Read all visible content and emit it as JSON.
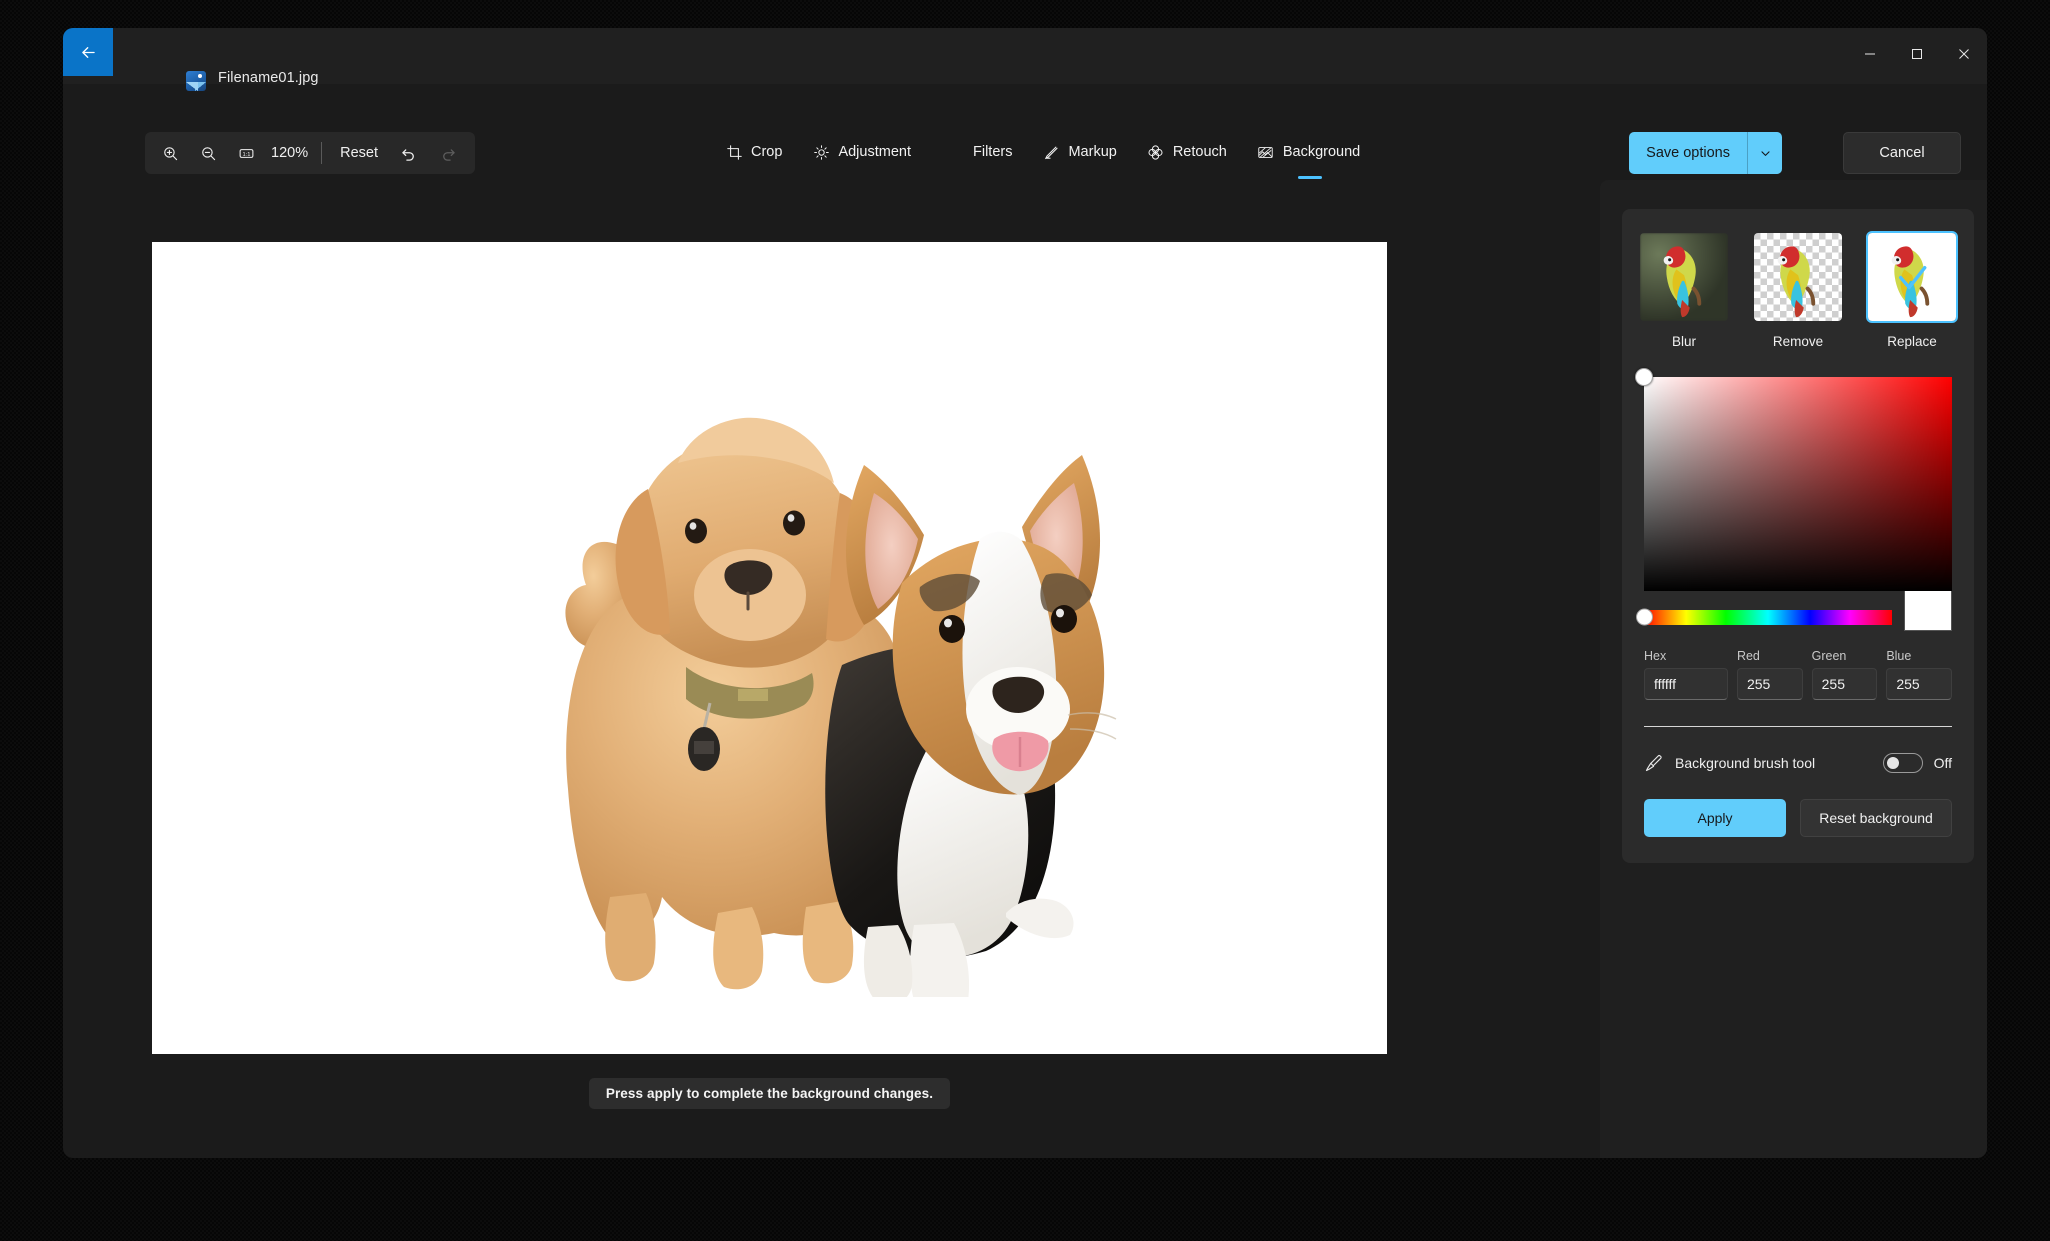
{
  "window": {
    "file_name": "Filename01.jpg",
    "back_label": "back-arrow",
    "controls": {
      "minimize": "minimize",
      "maximize": "maximize",
      "close": "close"
    }
  },
  "toolbar": {
    "zoom_in": "zoom-in",
    "zoom_out": "zoom-out",
    "actual_size": "1:1",
    "zoom_level": "120%",
    "reset_label": "Reset",
    "undo": "undo",
    "redo": "redo",
    "save_options_label": "Save options",
    "cancel_label": "Cancel"
  },
  "tabs": [
    {
      "label": "Crop",
      "icon": "crop-icon",
      "active": false
    },
    {
      "label": "Adjustment",
      "icon": "brightness-icon",
      "active": false
    },
    {
      "label": "Filters",
      "icon": "",
      "active": false
    },
    {
      "label": "Markup",
      "icon": "pen-icon",
      "active": false
    },
    {
      "label": "Retouch",
      "icon": "retouch-icon",
      "active": false
    },
    {
      "label": "Background",
      "icon": "background-icon",
      "active": true
    }
  ],
  "canvas": {
    "status_message": "Press apply to complete the background changes.",
    "image_alt": "Two puppies on white background"
  },
  "panel": {
    "background_modes": [
      {
        "label": "Blur",
        "thumb": "blurred-parrot",
        "selected": false
      },
      {
        "label": "Remove",
        "thumb": "transparent-parrot",
        "selected": false
      },
      {
        "label": "Replace",
        "thumb": "white-bg-parrot",
        "selected": true
      }
    ],
    "color_picker": {
      "hex_label": "Hex",
      "hex_value": "ffffff",
      "red_label": "Red",
      "red_value": "255",
      "green_label": "Green",
      "green_value": "255",
      "blue_label": "Blue",
      "blue_value": "255",
      "selected_color": "#ffffff"
    },
    "brush_tool": {
      "label": "Background brush tool",
      "state": "Off",
      "enabled": false
    },
    "apply_label": "Apply",
    "reset_background_label": "Reset background"
  },
  "colors": {
    "accent": "#61cdfb",
    "tab_underline": "#4cc2ff",
    "back_button": "#0a74c8",
    "window_bg": "#1b1b1b",
    "panel_bg": "#1f1f1f",
    "card_bg": "#2b2b2b",
    "canvas_bg": "#ffffff"
  }
}
